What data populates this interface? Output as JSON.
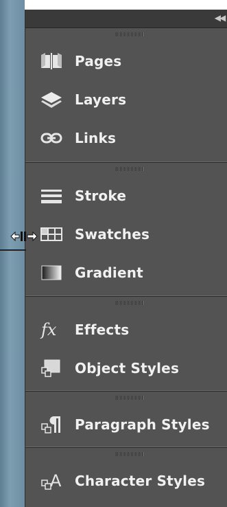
{
  "panel": {
    "collapse_icon": "double-chevron-right-icon",
    "groups": [
      {
        "items": [
          {
            "label": "Pages",
            "icon": "pages-icon"
          },
          {
            "label": "Layers",
            "icon": "layers-icon"
          },
          {
            "label": "Links",
            "icon": "links-icon"
          }
        ]
      },
      {
        "items": [
          {
            "label": "Stroke",
            "icon": "stroke-icon"
          },
          {
            "label": "Swatches",
            "icon": "swatches-icon"
          },
          {
            "label": "Gradient",
            "icon": "gradient-icon"
          }
        ]
      },
      {
        "items": [
          {
            "label": "Effects",
            "icon": "effects-icon"
          },
          {
            "label": "Object Styles",
            "icon": "object-styles-icon"
          }
        ]
      },
      {
        "items": [
          {
            "label": "Paragraph Styles",
            "icon": "paragraph-styles-icon"
          }
        ]
      },
      {
        "items": [
          {
            "label": "Character Styles",
            "icon": "character-styles-icon"
          }
        ]
      }
    ]
  },
  "resize_cursor_icon": "horizontal-resize-cursor-icon"
}
